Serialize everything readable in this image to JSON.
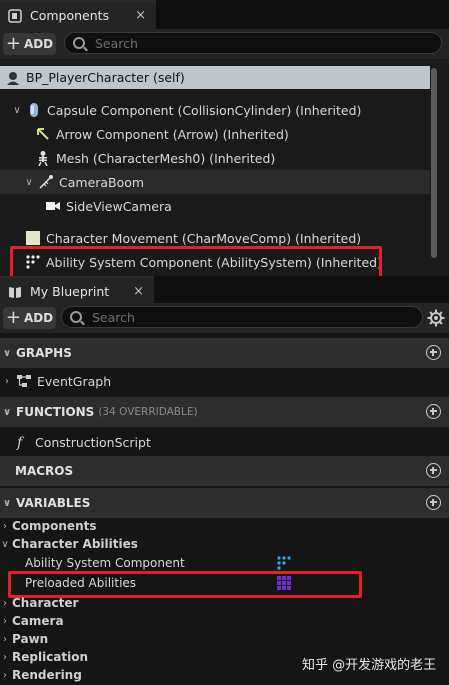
{
  "components_panel": {
    "tab_label": "Components",
    "close": "×",
    "add_label": "ADD",
    "search_placeholder": "Search",
    "tree": [
      {
        "label": "BP_PlayerCharacter (self)",
        "icon": "character-icon"
      },
      {
        "label": "Capsule Component (CollisionCylinder) (Inherited)",
        "icon": "capsule-icon"
      },
      {
        "label": "Arrow Component (Arrow) (Inherited)",
        "icon": "arrow-icon"
      },
      {
        "label": "Mesh (CharacterMesh0) (Inherited)",
        "icon": "skeleton-icon"
      },
      {
        "label": "CameraBoom",
        "icon": "spring-arm-icon"
      },
      {
        "label": "SideViewCamera",
        "icon": "camera-icon"
      },
      {
        "label": "Character Movement (CharMoveComp) (Inherited)",
        "icon": "movement-icon"
      },
      {
        "label": "Ability System Component (AbilitySystem) (Inherited)",
        "icon": "ability-system-icon"
      }
    ]
  },
  "blueprint_panel": {
    "tab_label": "My Blueprint",
    "close": "×",
    "add_label": "ADD",
    "search_placeholder": "Search",
    "sections": {
      "graphs": "GRAPHS",
      "functions": "FUNCTIONS",
      "functions_sub": "(34 OVERRIDABLE)",
      "macros": "MACROS",
      "variables": "VARIABLES"
    },
    "event_graph": "EventGraph",
    "construction_script": "ConstructionScript",
    "variable_categories": [
      "Components",
      "Character Abilities",
      "Character",
      "Camera",
      "Pawn",
      "Replication",
      "Rendering"
    ],
    "variables": [
      {
        "label": "Ability System Component",
        "color": "#3aa8e0"
      },
      {
        "label": "Preloaded Abilities",
        "color": "#7a2bd6"
      }
    ]
  },
  "watermark": "知乎 @开发游戏的老王",
  "colors": {
    "highlight_box": "#e0202a",
    "selected_row": "#bcc6cc",
    "panel_bg": "#151515"
  }
}
